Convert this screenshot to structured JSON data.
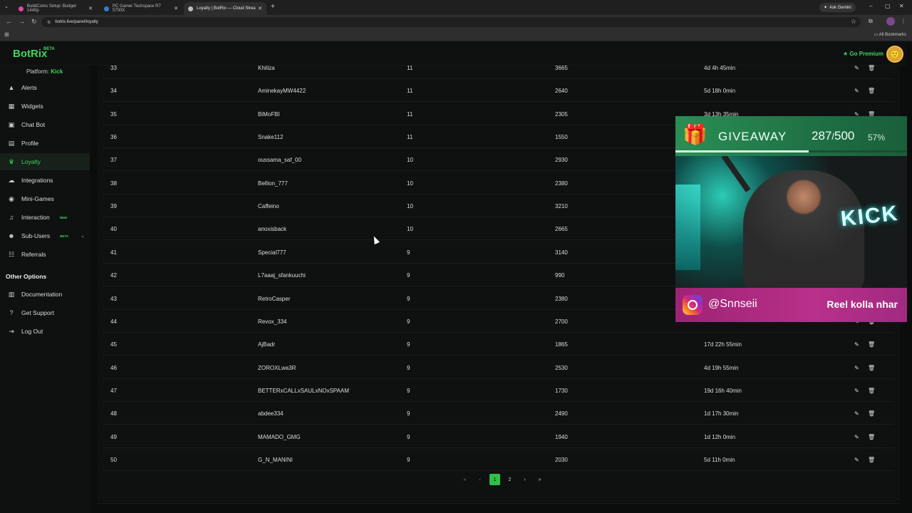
{
  "browser": {
    "tabs": [
      {
        "label": "BuildCores Setup: Budget 1440p",
        "color": "#e04da0"
      },
      {
        "label": "PC Gamer Techspace R7 5700X",
        "color": "#3a7bd5"
      },
      {
        "label": "Loyalty | BotRix — Cloud Strea",
        "color": "#bbbbbb"
      }
    ],
    "ask_gemini": "Ask Gemini",
    "url": "botrix.live/panel/loyalty",
    "all_bookmarks": "All Bookmarks"
  },
  "app": {
    "logo": "BotRix",
    "logo_badge": "BETA",
    "go_premium": "Go Premium",
    "platform_label": "Platform:",
    "platform_value": "Kick"
  },
  "sidebar": {
    "items": [
      {
        "label": "Alerts",
        "icon": "warning-icon"
      },
      {
        "label": "Widgets",
        "icon": "grid-icon"
      },
      {
        "label": "Chat Bot",
        "icon": "chat-icon"
      },
      {
        "label": "Profile",
        "icon": "id-card-icon"
      },
      {
        "label": "Loyalty",
        "icon": "trophy-icon"
      },
      {
        "label": "Integrations",
        "icon": "cloud-icon"
      },
      {
        "label": "Mini-Games",
        "icon": "gamepad-icon"
      },
      {
        "label": "Interaction",
        "icon": "music-icon",
        "badge": "NEW"
      },
      {
        "label": "Sub-Users",
        "icon": "users-icon",
        "badge": "BETA"
      },
      {
        "label": "Referrals",
        "icon": "referrals-icon"
      }
    ],
    "other_title": "Other Options",
    "other_items": [
      {
        "label": "Documentation",
        "icon": "book-icon"
      },
      {
        "label": "Get Support",
        "icon": "question-icon"
      },
      {
        "label": "Log Out",
        "icon": "logout-icon"
      }
    ]
  },
  "table": {
    "rows": [
      {
        "rank": "33",
        "name": "Khiliza",
        "level": "11",
        "points": "3665",
        "time": "4d 4h 45min"
      },
      {
        "rank": "34",
        "name": "AminekayMW4422",
        "level": "11",
        "points": "2640",
        "time": "5d 18h 0min"
      },
      {
        "rank": "35",
        "name": "BiMoFBI",
        "level": "11",
        "points": "2305",
        "time": "3d 13h 35min"
      },
      {
        "rank": "36",
        "name": "Snake112",
        "level": "11",
        "points": "1550",
        "time": ""
      },
      {
        "rank": "37",
        "name": "oussama_saf_00",
        "level": "10",
        "points": "2930",
        "time": ""
      },
      {
        "rank": "38",
        "name": "Bellion_777",
        "level": "10",
        "points": "2380",
        "time": ""
      },
      {
        "rank": "39",
        "name": "Caffeino",
        "level": "10",
        "points": "3210",
        "time": ""
      },
      {
        "rank": "40",
        "name": "anoxisback",
        "level": "10",
        "points": "2665",
        "time": ""
      },
      {
        "rank": "41",
        "name": "Special777",
        "level": "9",
        "points": "3140",
        "time": ""
      },
      {
        "rank": "42",
        "name": "L7aaaj_sfankuuchi",
        "level": "9",
        "points": "990",
        "time": ""
      },
      {
        "rank": "43",
        "name": "RetroCasper",
        "level": "9",
        "points": "2380",
        "time": ""
      },
      {
        "rank": "44",
        "name": "Revox_334",
        "level": "9",
        "points": "2700",
        "time": ""
      },
      {
        "rank": "45",
        "name": "AjBadr",
        "level": "9",
        "points": "1865",
        "time": "17d 22h 55min"
      },
      {
        "rank": "46",
        "name": "ZOROXLwa3R",
        "level": "9",
        "points": "2530",
        "time": "4d 19h 55min"
      },
      {
        "rank": "47",
        "name": "BETTERxCALLxSAULxNOxSPAAM",
        "level": "9",
        "points": "1730",
        "time": "19d 16h 40min"
      },
      {
        "rank": "48",
        "name": "abdee334",
        "level": "9",
        "points": "2490",
        "time": "1d 17h 30min"
      },
      {
        "rank": "49",
        "name": "MAMADO_GMG",
        "level": "9",
        "points": "1940",
        "time": "1d 12h 0min"
      },
      {
        "rank": "50",
        "name": "G_N_MANINI",
        "level": "9",
        "points": "2030",
        "time": "5d 11h 0min"
      }
    ]
  },
  "pagination": {
    "first": "«",
    "prev": "‹",
    "pages": [
      "1",
      "2"
    ],
    "current": "1",
    "next": "›",
    "last": "»"
  },
  "overlay": {
    "giveaway_title": "GIVEAWAY",
    "current": "287",
    "separator": "/",
    "total": "500",
    "percent": "57%",
    "progress": 0.57,
    "neon_sign": "KICK",
    "instagram_handle": "@Snnseii",
    "tagline": "Reel kolla nhar"
  },
  "colors": {
    "accent": "#3fd45d",
    "giveaway_green": "#2a8f55",
    "instagram_pink": "#b8308a"
  }
}
